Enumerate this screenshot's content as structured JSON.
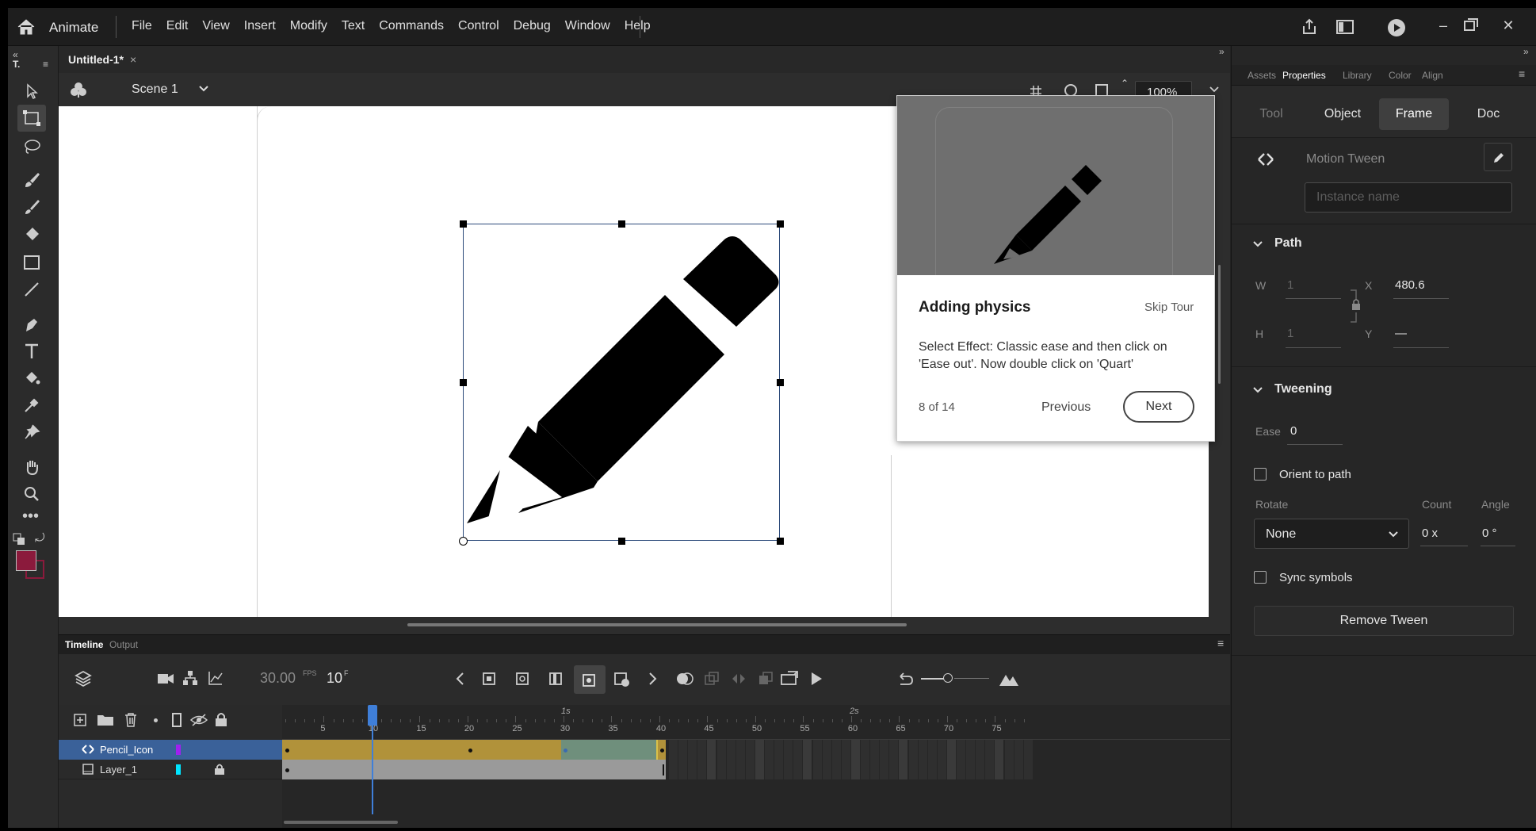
{
  "app": {
    "name": "Animate"
  },
  "menu": [
    "File",
    "Edit",
    "View",
    "Insert",
    "Modify",
    "Text",
    "Commands",
    "Control",
    "Debug",
    "Window",
    "Help"
  ],
  "document": {
    "tab": "Untitled-1*",
    "scene": "Scene 1",
    "zoom": "100%"
  },
  "tour": {
    "title": "Adding physics",
    "skip": "Skip Tour",
    "body": "Select Effect: Classic ease and then click on 'Ease out'. Now double click on 'Quart'",
    "step": "8 of 14",
    "previous": "Previous",
    "next": "Next"
  },
  "timeline": {
    "tabs": [
      "Timeline",
      "Output"
    ],
    "fps": "30.00",
    "fps_unit": "FPS",
    "frame": "10",
    "frame_unit": "F",
    "ruler": [
      "5",
      "10",
      "15",
      "20",
      "25",
      "30",
      "35",
      "40",
      "45",
      "50",
      "55",
      "60",
      "65",
      "70",
      "75"
    ],
    "seconds": [
      "1s",
      "2s"
    ],
    "current_frame": 10,
    "layers": [
      {
        "name": "Pencil_Icon",
        "color": "#a020f0",
        "selected": true
      },
      {
        "name": "Layer_1",
        "color": "#00e5ff",
        "locked": true
      }
    ]
  },
  "tools_colors": {
    "stroke": "#8b1a3c",
    "fill": "#8b1a3c"
  },
  "properties": {
    "tabs": [
      "Assets",
      "Properties",
      "Library",
      "Color",
      "Align"
    ],
    "segments": [
      "Tool",
      "Object",
      "Frame",
      "Doc"
    ],
    "type": "Motion Tween",
    "instance_placeholder": "Instance name",
    "path_title": "Path",
    "w_label": "W",
    "w_value": "1",
    "h_label": "H",
    "h_value": "1",
    "x_label": "X",
    "x_value": "480.6",
    "y_label": "Y",
    "y_value": "—",
    "tweening_title": "Tweening",
    "ease_label": "Ease",
    "ease_value": "0",
    "orient": "Orient to path",
    "rotate_label": "Rotate",
    "rotate_value": "None",
    "count_label": "Count",
    "count_value": "0 x",
    "angle_label": "Angle",
    "angle_value": "0 °",
    "sync": "Sync symbols",
    "remove": "Remove Tween"
  }
}
